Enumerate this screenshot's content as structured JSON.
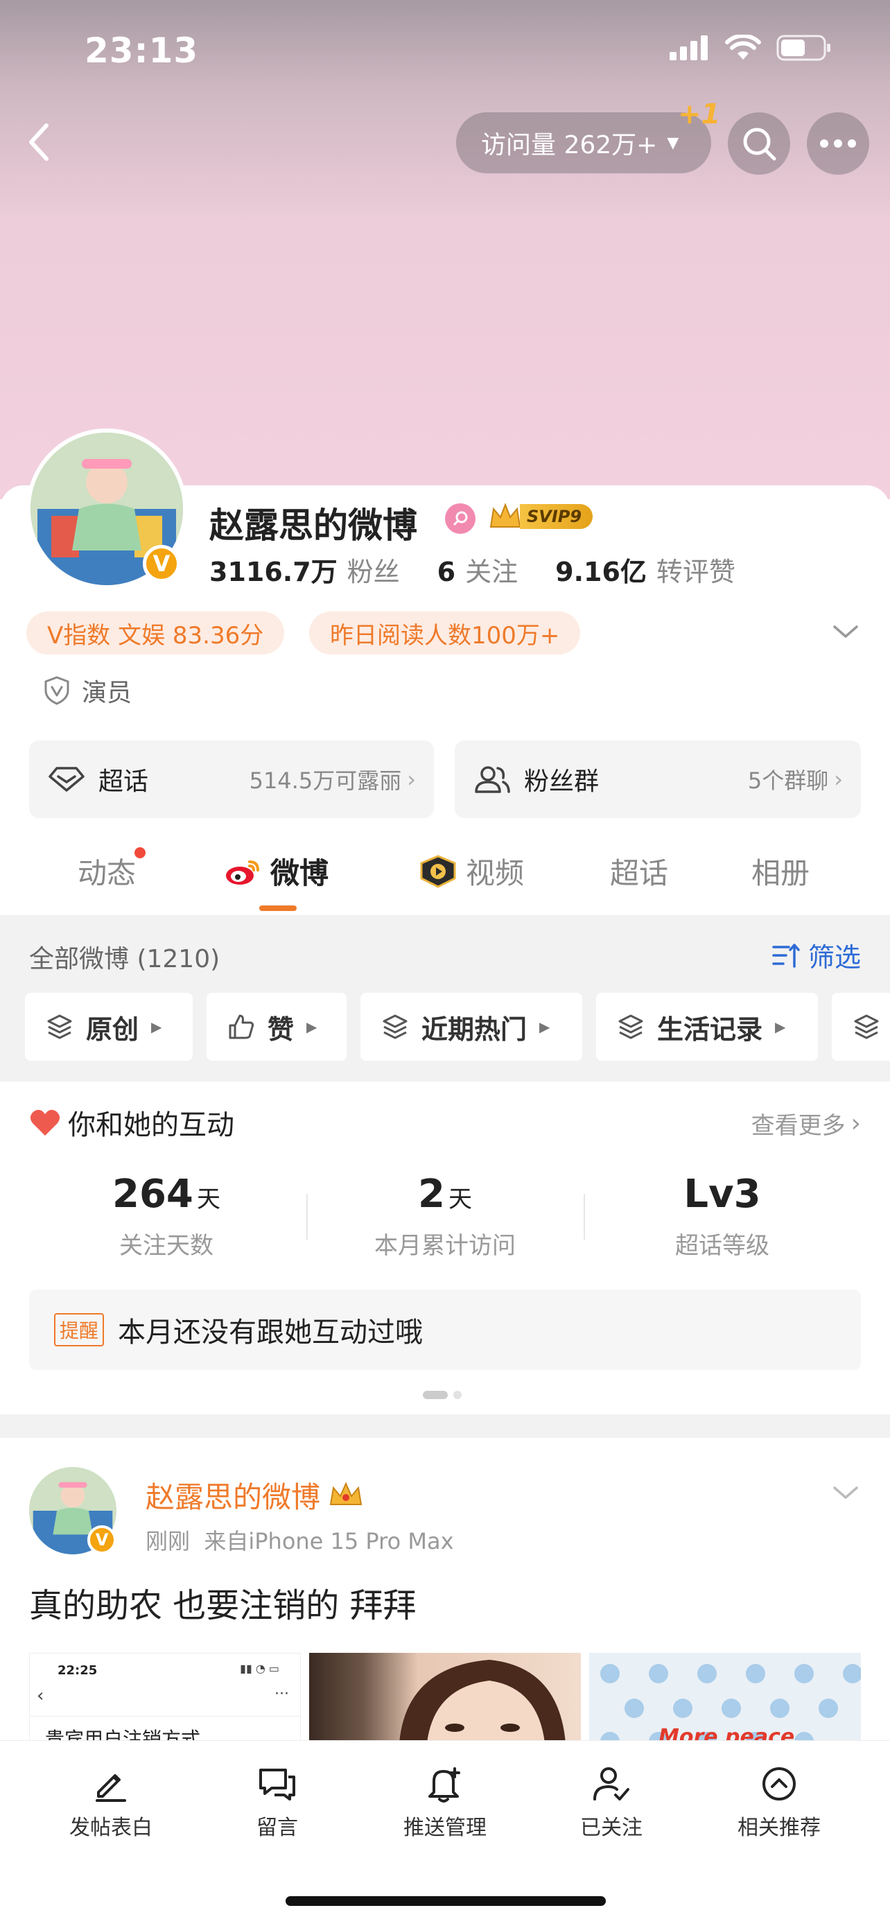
{
  "status_bar": {
    "time": "23:13"
  },
  "header": {
    "visits_label": "访问量 262万+",
    "visits_increment": "+1"
  },
  "profile": {
    "name": "赵露思的微博",
    "svip_label": "SVIP9",
    "avatar_badge": "V",
    "followers_count": "3116.7万",
    "followers_label": "粉丝",
    "following_count": "6",
    "following_label": "关注",
    "interactions_count": "9.16亿",
    "interactions_label": "转评赞",
    "tags": [
      "V指数 文娱 83.36分",
      "昨日阅读人数100万+"
    ],
    "role": "演员"
  },
  "entries": [
    {
      "title": "超话",
      "subtitle": "514.5万可露丽"
    },
    {
      "title": "粉丝群",
      "subtitle": "5个群聊"
    }
  ],
  "tabs": [
    {
      "label": "动态"
    },
    {
      "label": "微博"
    },
    {
      "label": "视频"
    },
    {
      "label": "超话"
    },
    {
      "label": "相册"
    }
  ],
  "feed": {
    "total_label": "全部微博 (1210)",
    "filter_label": "筛选",
    "chips": [
      "原创",
      "赞",
      "近期热门",
      "生活记录"
    ]
  },
  "interaction": {
    "title": "你和她的互动",
    "more_label": "查看更多",
    "stats": [
      {
        "value": "264",
        "unit": "天",
        "label": "关注天数"
      },
      {
        "value": "2",
        "unit": "天",
        "label": "本月累计访问"
      },
      {
        "value": "Lv3",
        "unit": "",
        "label": "超话等级"
      }
    ],
    "reminder_badge": "提醒",
    "reminder_text": "本月还没有跟她互动过哦"
  },
  "post": {
    "author": "赵露思的微博",
    "meta": "刚刚  来自iPhone 15 Pro Max",
    "text": "真的助农 也要注销的 拜拜",
    "thumb1_time": "22:25",
    "thumb1_title": "贵宾用户注销方式",
    "thumb3_text": "More peace"
  },
  "bottom_bar": [
    {
      "label": "发帖表白"
    },
    {
      "label": "留言"
    },
    {
      "label": "推送管理"
    },
    {
      "label": "已关注"
    },
    {
      "label": "相关推荐"
    }
  ],
  "colors": {
    "accent": "#ef7a2a",
    "hero_pink": "#f3d0de",
    "gold": "#f4a40f"
  }
}
